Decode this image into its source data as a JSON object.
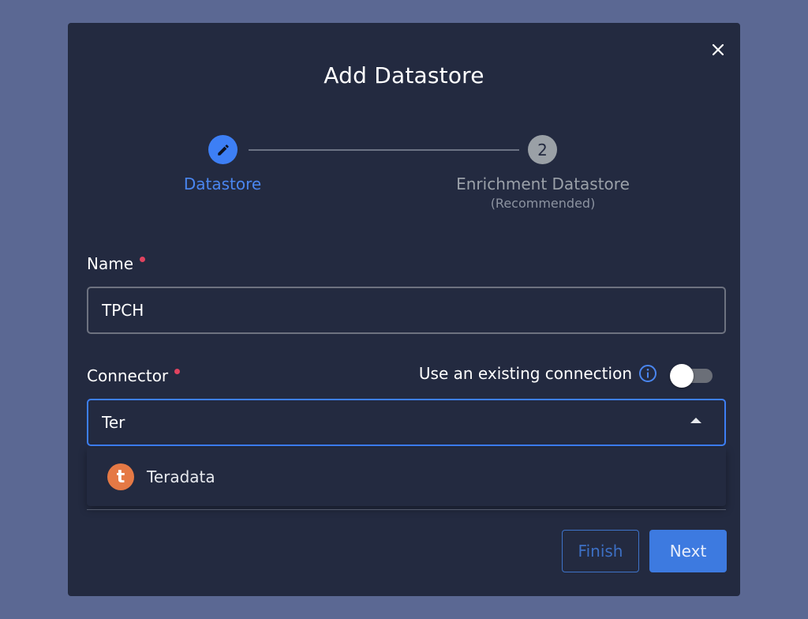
{
  "dialog": {
    "title": "Add Datastore",
    "close_icon": "close-icon"
  },
  "stepper": {
    "steps": [
      {
        "label": "Datastore",
        "icon": "pencil-icon",
        "state": "active"
      },
      {
        "label": "Enrichment Datastore",
        "number": "2",
        "sublabel": "(Recommended)",
        "state": "inactive"
      }
    ]
  },
  "form": {
    "name": {
      "label": "Name",
      "value": "TPCH"
    },
    "connector": {
      "label": "Connector",
      "value": "Ter",
      "existing_connection_label": "Use an existing connection",
      "existing_connection_enabled": false,
      "options": [
        {
          "label": "Teradata",
          "logo_letter": "t"
        }
      ]
    }
  },
  "buttons": {
    "finish": "Finish",
    "next": "Next"
  },
  "colors": {
    "accent": "#3d7ff5",
    "required": "#e0435f",
    "teradata": "#e57945"
  }
}
